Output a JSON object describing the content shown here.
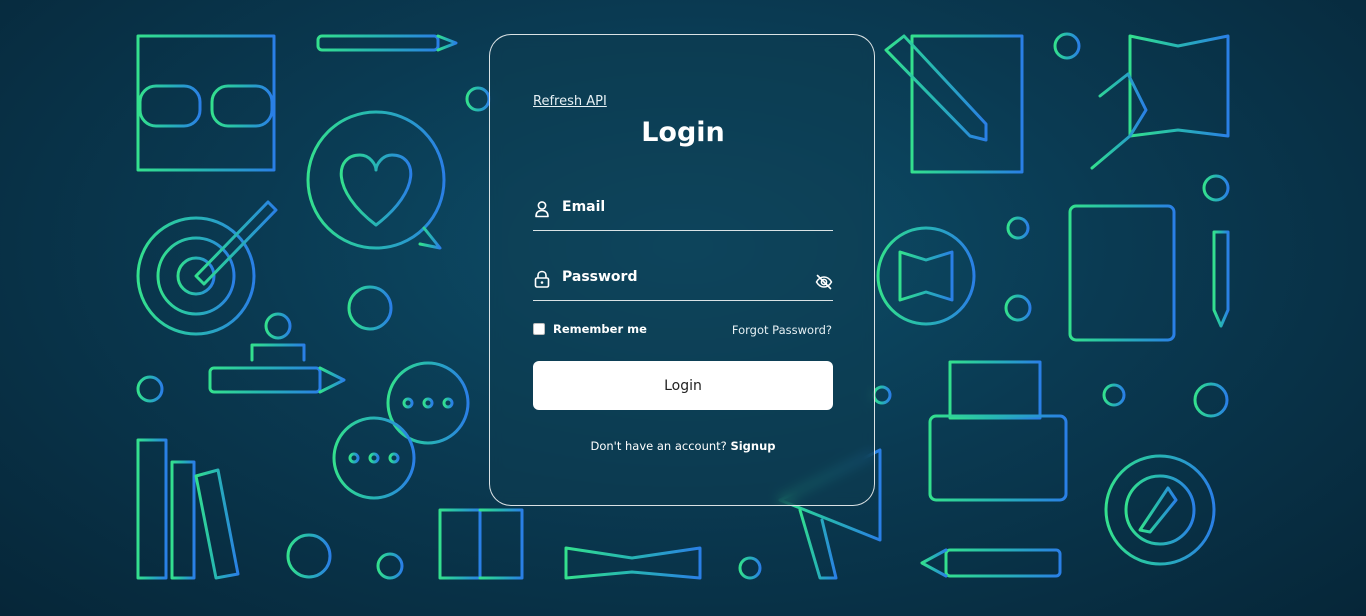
{
  "links": {
    "refresh_api": "Refresh API",
    "forgot_password": "Forgot Password?",
    "signup": "Signup"
  },
  "form": {
    "title": "Login",
    "email_label": "Email",
    "password_label": "Password",
    "remember_me": "Remember me",
    "remember_checked": false,
    "submit_label": "Login",
    "no_account_text": "Don't have an account?"
  },
  "icons": {
    "email": "user-icon",
    "password": "lock-icon",
    "toggle_password": "eye-off-icon"
  },
  "colors": {
    "background": "#0a3a52",
    "button": "#ffffff",
    "text": "#ffffff",
    "icons_green": "#2fd69a",
    "icons_blue": "#2f8fe0"
  }
}
